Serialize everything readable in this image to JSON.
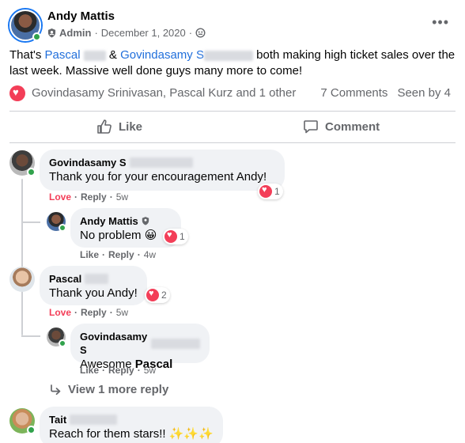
{
  "post": {
    "author": "Andy Mattis",
    "role": "Admin",
    "date": "December 1, 2020",
    "more_icon": "•••",
    "text_prefix": "That's ",
    "mention_1": "Pascal",
    "text_amp": " & ",
    "mention_2": "Govindasamy S",
    "text_suffix": " both making high ticket sales over the last week. Massive well done guys many more to come!",
    "reactors": "Govindasamy Srinivasan, Pascal Kurz and 1 other",
    "comments_count": "7 Comments",
    "seen_by": "Seen by 4"
  },
  "actions": {
    "like": "Like",
    "comment": "Comment"
  },
  "comments": [
    {
      "name": "Govindasamy S",
      "text": "Thank you for your encouragement Andy!",
      "action_love": "Love",
      "reply": "Reply",
      "time": "5w",
      "reactions": "1"
    },
    {
      "name": "Andy Mattis",
      "text": "No problem 😀",
      "action_like": "Like",
      "reply": "Reply",
      "time": "4w",
      "reactions": "1"
    },
    {
      "name": "Pascal",
      "text": "Thank you Andy!",
      "action_love": "Love",
      "reply": "Reply",
      "time": "5w",
      "reactions": "2"
    },
    {
      "name": "Govindasamy S",
      "text_prefix": "Awesome ",
      "text_bold": "Pascal",
      "action_like": "Like",
      "reply": "Reply",
      "time": "5w"
    },
    {
      "name": "Tait",
      "text": "Reach for them stars!! ✨✨✨"
    }
  ],
  "view_more": "View 1 more reply",
  "colors": {
    "accent": "#1877f2",
    "mention": "#216fdb",
    "love": "#f33e58",
    "online": "#31a24c",
    "bubble": "#f0f2f5"
  }
}
